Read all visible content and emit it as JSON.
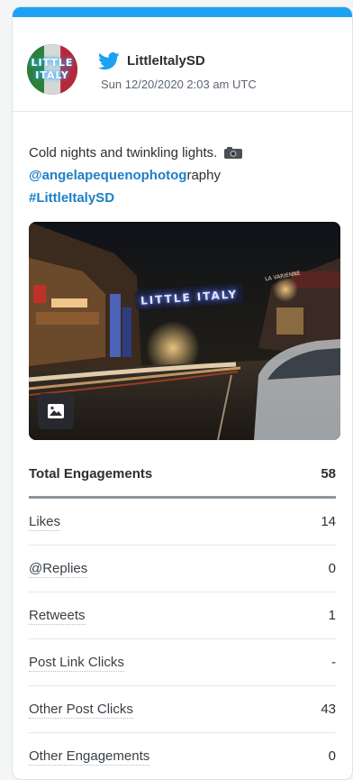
{
  "post": {
    "handle": "LittleItalySD",
    "timestamp": "Sun 12/20/2020 2:03 am UTC",
    "avatar_text": [
      "LITTLE",
      "ITALY"
    ],
    "text_line1": "Cold nights and twinkling lights.",
    "mention": "@angelapequenophotog",
    "mention_suffix": "raphy",
    "hashtag": "#LittleItalySD",
    "photo_sign": "LITTLE ITALY",
    "photo_sign_small": "LA VARIENNE"
  },
  "icons": {
    "platform": "twitter-bird-icon",
    "camera": "camera-emoji-icon",
    "image_badge": "image-icon"
  },
  "colors": {
    "accent": "#1da1f2",
    "link": "#1d7fc7"
  },
  "metrics": {
    "total": {
      "label": "Total Engagements",
      "value": "58"
    },
    "rows": [
      {
        "label": "Likes",
        "value": "14"
      },
      {
        "label": "@Replies",
        "value": "0"
      },
      {
        "label": "Retweets",
        "value": "1"
      },
      {
        "label": "Post Link Clicks",
        "value": "-"
      },
      {
        "label": "Other Post Clicks",
        "value": "43"
      },
      {
        "label": "Other Engagements",
        "value": "0"
      }
    ]
  }
}
